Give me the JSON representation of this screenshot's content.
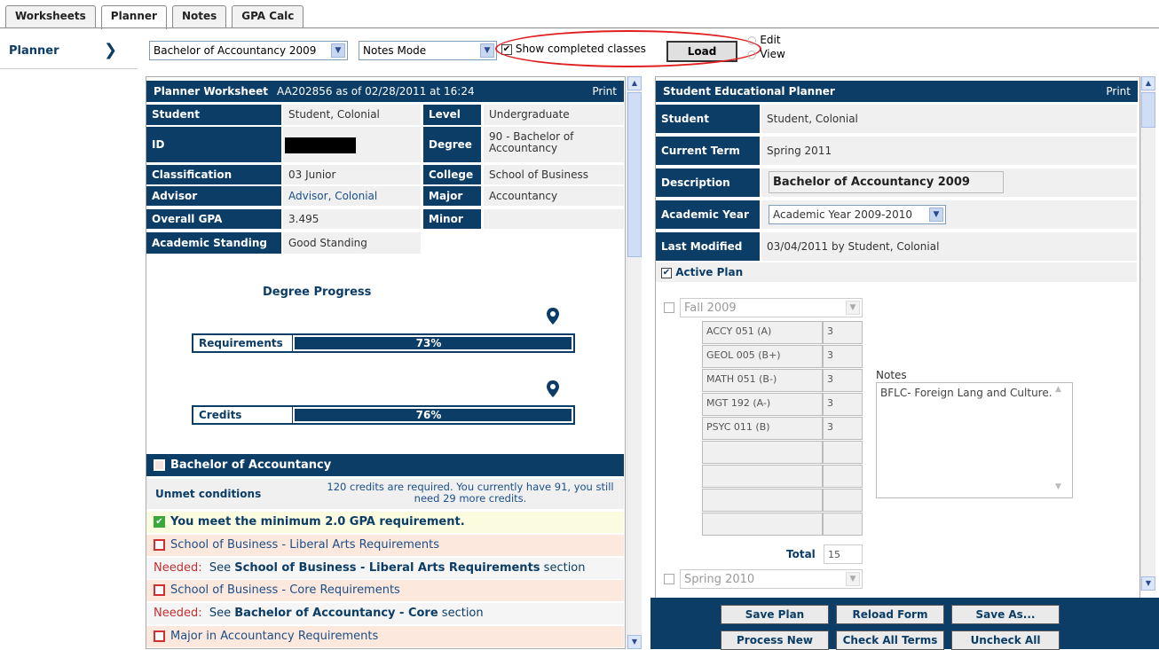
{
  "tabs": [
    "Worksheets",
    "Planner",
    "Notes",
    "GPA Calc"
  ],
  "sidebar": {
    "label": "Planner"
  },
  "toolbar": {
    "degree_select": "Bachelor of Accountancy 2009",
    "mode_select": "Notes Mode",
    "show_completed": "Show completed classes",
    "load": "Load",
    "radio_edit": "Edit",
    "radio_view": "View"
  },
  "worksheet": {
    "title": "Planner Worksheet",
    "subtitle": "AA202856 as of 02/28/2011 at 16:24",
    "print": "Print",
    "student_lbl": "Student",
    "student": "Student, Colonial",
    "level_lbl": "Level",
    "level": "Undergraduate",
    "id_lbl": "ID",
    "degree_lbl": "Degree",
    "degree": "90 - Bachelor of Accountancy",
    "class_lbl": "Classification",
    "class": "03 Junior",
    "college_lbl": "College",
    "college": "School of Business",
    "advisor_lbl": "Advisor",
    "advisor": "Advisor, Colonial",
    "major_lbl": "Major",
    "major": "Accountancy",
    "gpa_lbl": "Overall GPA",
    "gpa": "3.495",
    "minor_lbl": "Minor",
    "standing_lbl": "Academic Standing",
    "standing": "Good Standing",
    "progress_title": "Degree Progress",
    "req_lbl": "Requirements",
    "req_pct": "73%",
    "req_fraction": 0.73,
    "cred_lbl": "Credits",
    "cred_pct": "76%",
    "cred_fraction": 0.76,
    "section_title": "Bachelor of Accountancy",
    "unmet_lbl": "Unmet conditions",
    "unmet_text": "120 credits are required. You currently have 91, you still need 29 more credits.",
    "gpa_met": "You meet the minimum 2.0 GPA requirement.",
    "req1": "School of Business - Liberal Arts Requirements",
    "needed_lbl": "Needed:",
    "see": "See",
    "section_word": "section",
    "need1": "School of Business - Liberal Arts Requirements",
    "req2": "School of Business - Core Requirements",
    "need2": "Bachelor of Accountancy - Core",
    "req3": "Major in Accountancy Requirements"
  },
  "planner": {
    "title": "Student Educational Planner",
    "print": "Print",
    "student_lbl": "Student",
    "student": "Student, Colonial",
    "term_lbl": "Current Term",
    "term": "Spring 2011",
    "desc_lbl": "Description",
    "desc": "Bachelor of Accountancy 2009",
    "year_lbl": "Academic Year",
    "year": "Academic Year 2009-2010",
    "mod_lbl": "Last Modified",
    "mod": "03/04/2011 by Student, Colonial",
    "active": "Active Plan",
    "term1": "Fall 2009",
    "courses": [
      {
        "c": "ACCY 051 (A)",
        "h": "3"
      },
      {
        "c": "GEOL 005 (B+)",
        "h": "3"
      },
      {
        "c": "MATH 051 (B-)",
        "h": "3"
      },
      {
        "c": "MGT 192 (A-)",
        "h": "3"
      },
      {
        "c": "PSYC 011 (B)",
        "h": "3"
      }
    ],
    "notes_lbl": "Notes",
    "notes": "BFLC- Foreign Lang and Culture.",
    "total_lbl": "Total",
    "total": "15",
    "term2": "Spring 2010",
    "buttons": [
      "Save Plan",
      "Reload Form",
      "Save As...",
      "Process New",
      "Check All Terms",
      "Uncheck All"
    ]
  }
}
